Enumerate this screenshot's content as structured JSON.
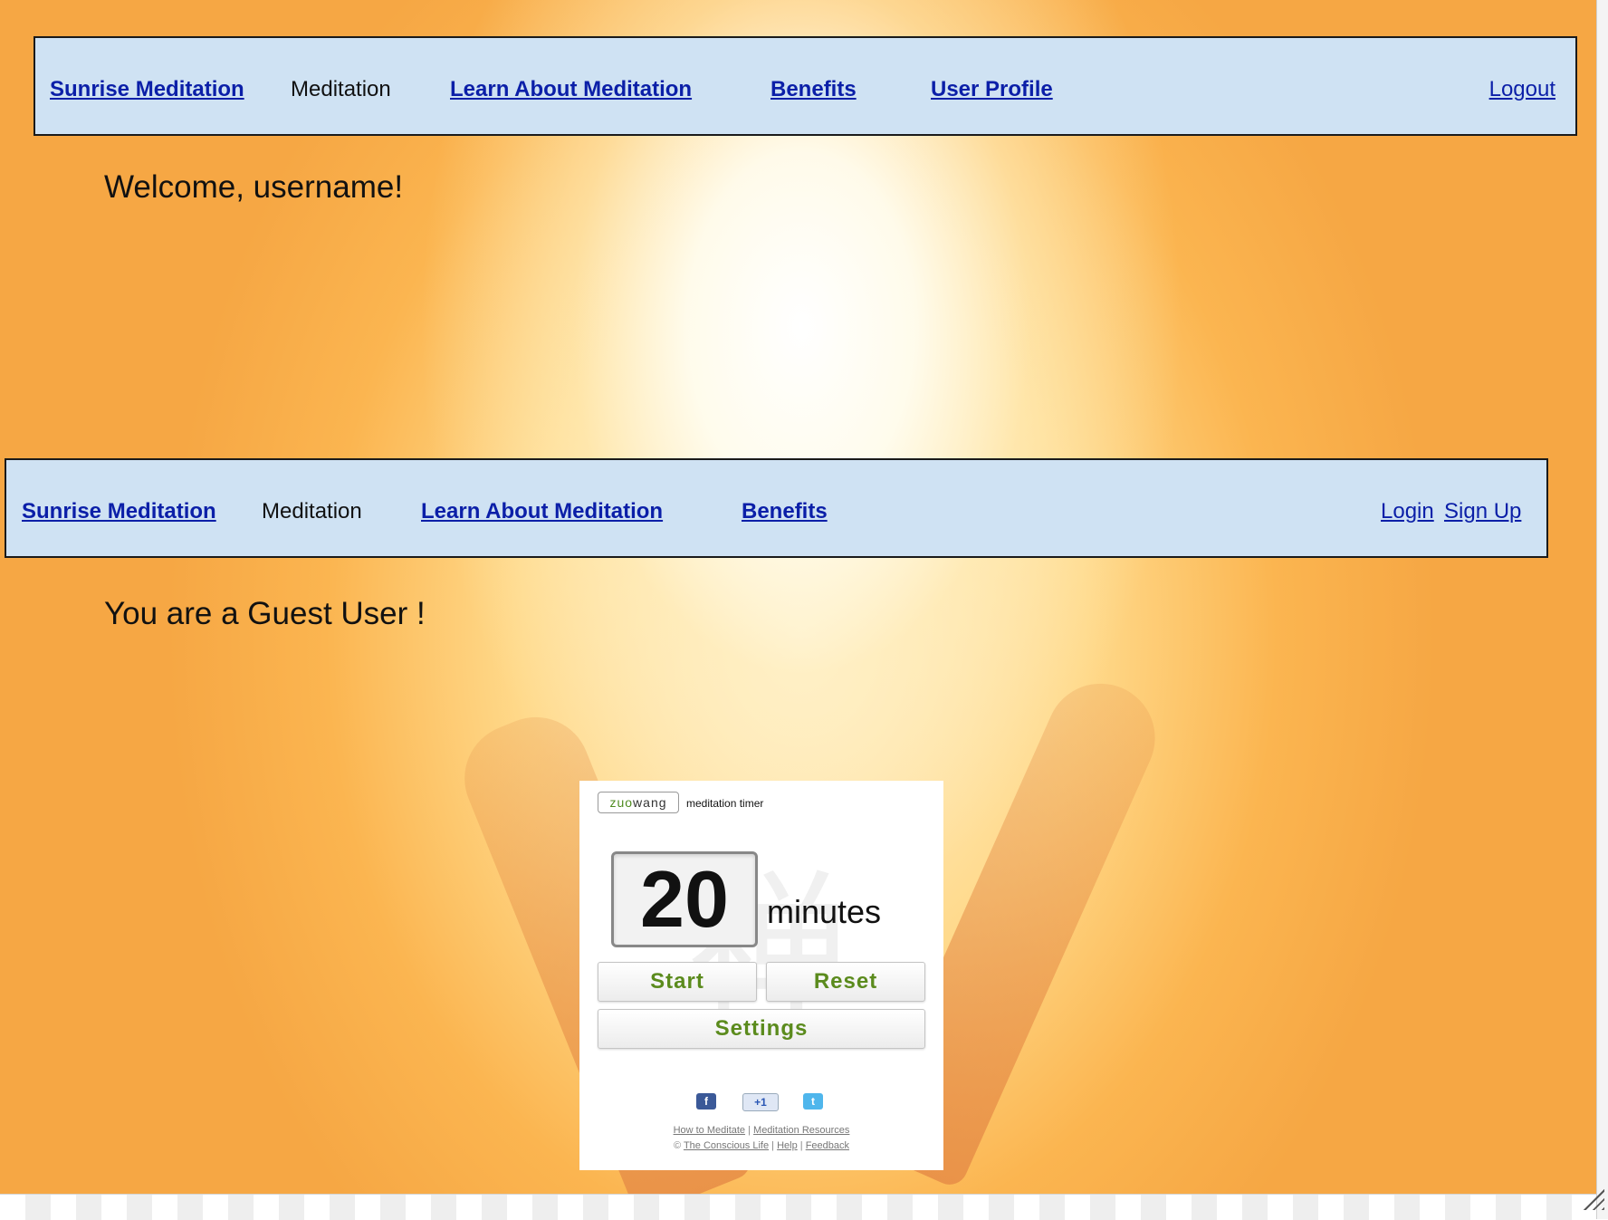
{
  "nav_logged_in": {
    "brand": "Sunrise Meditation",
    "current": "Meditation",
    "learn": "Learn About Meditation",
    "benefits": "Benefits",
    "profile": "User Profile",
    "logout": "Logout"
  },
  "welcome_text": "Welcome, username!",
  "nav_guest": {
    "brand": "Sunrise Meditation",
    "current": "Meditation",
    "learn": "Learn About Meditation",
    "benefits": "Benefits",
    "login": "Login",
    "signup": "Sign Up"
  },
  "guest_text": "You are a Guest User !",
  "timer": {
    "logo_zuo": "zuo",
    "logo_wang": "wang",
    "subtitle": "meditation timer",
    "minutes_value": "20",
    "minutes_unit": "minutes",
    "start_label": "Start",
    "reset_label": "Reset",
    "settings_label": "Settings",
    "social": {
      "facebook": "f",
      "google_plus": "+1",
      "twitter": "t"
    },
    "footer": {
      "how_to": "How to Meditate",
      "resources": "Meditation Resources",
      "copyright": "©",
      "conscious_life": "The Conscious Life",
      "help": "Help",
      "feedback": "Feedback",
      "separator": "|"
    }
  },
  "colors": {
    "nav_background": "#cfe2f3",
    "link": "#0b1fa8",
    "button_text": "#5b8b1d",
    "logo_green": "#4e8a1f"
  }
}
